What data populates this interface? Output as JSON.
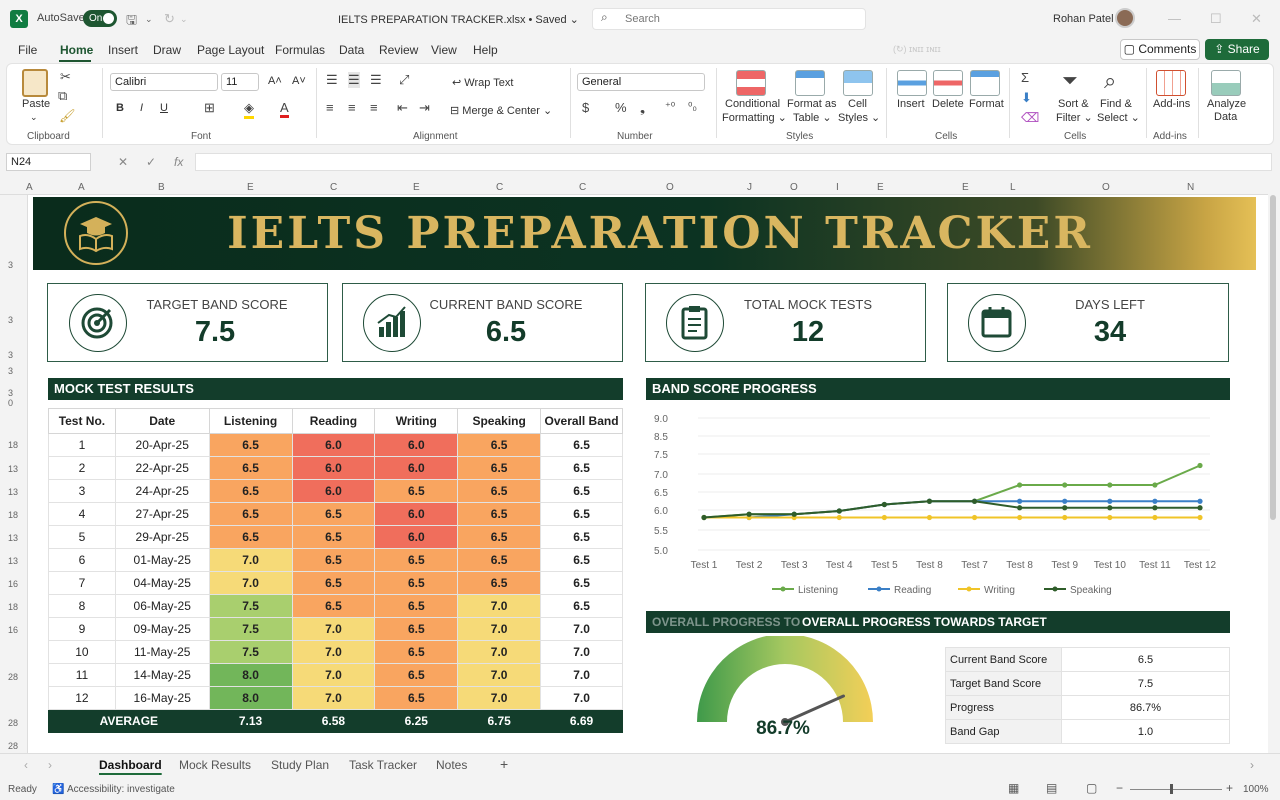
{
  "titlebar": {
    "autosave_label": "AutoSave",
    "autosave_state": "On",
    "doc_title": "IELTS PREPARATION TRACKER.xlsx • Saved ⌄",
    "search_placeholder": "Search",
    "user_name": "Rohan Patel"
  },
  "menu": [
    "File",
    "Home",
    "Insert",
    "Draw",
    "Page Layout",
    "Formulas",
    "Data",
    "Review",
    "View",
    "Help"
  ],
  "menu_ghost": "(↻) ɪɴɪɪ ɪɴɪɪ",
  "buttons": {
    "comments": "Comments",
    "share": "Share"
  },
  "ribbon": {
    "clipboard": {
      "paste": "Paste",
      "group": "Clipboard"
    },
    "font": {
      "name": "Calibri",
      "size": "11",
      "group": "Font",
      "bold": "B",
      "italic": "I",
      "underline": "U"
    },
    "alignment": {
      "wrap": "Wrap Text",
      "merge": "Merge & Center",
      "group": "Alignment"
    },
    "number": {
      "format": "General",
      "group": "Number"
    },
    "styles": {
      "cond1": "Conditional",
      "cond2": "Formatting ⌄",
      "table1": "Format as",
      "table2": "Table ⌄",
      "cell1": "Cell",
      "cell2": "Styles ⌄",
      "group": "Styles"
    },
    "cells": {
      "insert": "Insert",
      "delete": "Delete",
      "format": "Format",
      "group": "Cells"
    },
    "editing": {
      "sort1": "Sort &",
      "sort2": "Filter ⌄",
      "find1": "Find &",
      "find2": "Select ⌄",
      "group": "Cells"
    },
    "addins": {
      "label": "Add-ins",
      "group": "Add-ins"
    },
    "analyze": {
      "l1": "Analyze",
      "l2": "Data"
    }
  },
  "formula_bar": {
    "name_box": "N24",
    "fx": "fx"
  },
  "column_headers": [
    "A",
    "A",
    "B",
    "E",
    "C",
    "E",
    "C",
    "C",
    "O",
    "J",
    "O",
    "I",
    "E",
    "E",
    "L",
    "O",
    "N"
  ],
  "row_headers": [
    "3",
    "3",
    "3",
    "3",
    "3",
    "0",
    "18",
    "13",
    "13",
    "18",
    "13",
    "13",
    "16",
    "18",
    "16",
    "28",
    "28",
    "28"
  ],
  "banner": {
    "title": "IELTS PREPARATION TRACKER"
  },
  "kpis": [
    {
      "label": "TARGET BAND SCORE",
      "value": "7.5",
      "icon": "target-icon"
    },
    {
      "label": "CURRENT BAND SCORE",
      "value": "6.5",
      "icon": "bar-chart-icon"
    },
    {
      "label": "TOTAL MOCK TESTS",
      "value": "12",
      "icon": "clipboard-icon"
    },
    {
      "label": "DAYS LEFT",
      "value": "34",
      "icon": "calendar-icon"
    }
  ],
  "mock_results": {
    "title": "MOCK TEST RESULTS",
    "headers": [
      "Test No.",
      "Date",
      "Listening",
      "Reading",
      "Writing",
      "Speaking",
      "Overall Band"
    ],
    "rows": [
      [
        "1",
        "20-Apr-25",
        "6.5",
        "6.0",
        "6.0",
        "6.5",
        "6.5"
      ],
      [
        "2",
        "22-Apr-25",
        "6.5",
        "6.0",
        "6.0",
        "6.5",
        "6.5"
      ],
      [
        "3",
        "24-Apr-25",
        "6.5",
        "6.0",
        "6.5",
        "6.5",
        "6.5"
      ],
      [
        "4",
        "27-Apr-25",
        "6.5",
        "6.5",
        "6.0",
        "6.5",
        "6.5"
      ],
      [
        "5",
        "29-Apr-25",
        "6.5",
        "6.5",
        "6.0",
        "6.5",
        "6.5"
      ],
      [
        "6",
        "01-May-25",
        "7.0",
        "6.5",
        "6.5",
        "6.5",
        "6.5"
      ],
      [
        "7",
        "04-May-25",
        "7.0",
        "6.5",
        "6.5",
        "6.5",
        "6.5"
      ],
      [
        "8",
        "06-May-25",
        "7.5",
        "6.5",
        "6.5",
        "7.0",
        "6.5"
      ],
      [
        "9",
        "09-May-25",
        "7.5",
        "7.0",
        "6.5",
        "7.0",
        "7.0"
      ],
      [
        "10",
        "11-May-25",
        "7.5",
        "7.0",
        "6.5",
        "7.0",
        "7.0"
      ],
      [
        "11",
        "14-May-25",
        "8.0",
        "7.0",
        "6.5",
        "7.0",
        "7.0"
      ],
      [
        "12",
        "16-May-25",
        "8.0",
        "7.0",
        "6.5",
        "7.0",
        "7.0"
      ]
    ],
    "average_row": [
      "AVERAGE",
      "7.13",
      "6.58",
      "6.25",
      "6.75",
      "6.69"
    ]
  },
  "band_progress": {
    "title": "BAND SCORE PROGRESS"
  },
  "chart_data": {
    "type": "line",
    "title": "BAND SCORE PROGRESS",
    "categories": [
      "Test 1",
      "Test 2",
      "Test 3",
      "Test 4",
      "Test 5",
      "Test 8",
      "Test 7",
      "Test 8",
      "Test 9",
      "Test 10",
      "Test 11",
      "Test 12"
    ],
    "y_ticks": [
      "9.0",
      "8.5",
      "7.5",
      "7.0",
      "6.5",
      "6.0",
      "5.5",
      "5.0"
    ],
    "ylim": [
      5.0,
      9.0
    ],
    "series": [
      {
        "name": "Listening",
        "color": "#6aaa4a",
        "values": [
          6.0,
          6.1,
          6.1,
          6.2,
          6.4,
          6.5,
          6.5,
          7.0,
          7.0,
          7.0,
          7.0,
          7.6
        ]
      },
      {
        "name": "Reading",
        "color": "#3a7fc6",
        "values": [
          6.0,
          6.0,
          6.1,
          6.2,
          6.4,
          6.5,
          6.5,
          6.5,
          6.5,
          6.5,
          6.5,
          6.5
        ]
      },
      {
        "name": "Writing",
        "color": "#f0c428",
        "values": [
          6.0,
          6.0,
          6.0,
          6.0,
          6.0,
          6.0,
          6.0,
          6.0,
          6.0,
          6.0,
          6.0,
          6.0
        ]
      },
      {
        "name": "Speaking",
        "color": "#2f5d2a",
        "values": [
          6.0,
          6.1,
          6.1,
          6.2,
          6.4,
          6.5,
          6.5,
          6.3,
          6.3,
          6.3,
          6.3,
          6.3
        ]
      }
    ],
    "legend_position": "bottom",
    "grid": true
  },
  "overall": {
    "title": "OVERALL PROGRESS TOWARDS TARGET",
    "ghost_title": "OVERALL PROGRESS TO",
    "gauge_value": "86.7%",
    "gauge_fraction": 0.867,
    "rows": [
      [
        "Current Band Score",
        "6.5"
      ],
      [
        "Target Band Score",
        "7.5"
      ],
      [
        "Progress",
        "86.7%"
      ],
      [
        "Band Gap",
        "1.0"
      ]
    ]
  },
  "tabs": [
    "Dashboard",
    "Mock Results",
    "Study Plan",
    "Task Tracker",
    "Notes"
  ],
  "add_tab": "+",
  "status": {
    "ready": "Ready",
    "accessibility": "Accessibility: investigate",
    "zoom": "100%"
  },
  "colors": {
    "dark_green": "#133d2b",
    "gold": "#d9b660",
    "excel_green": "#107c41"
  }
}
